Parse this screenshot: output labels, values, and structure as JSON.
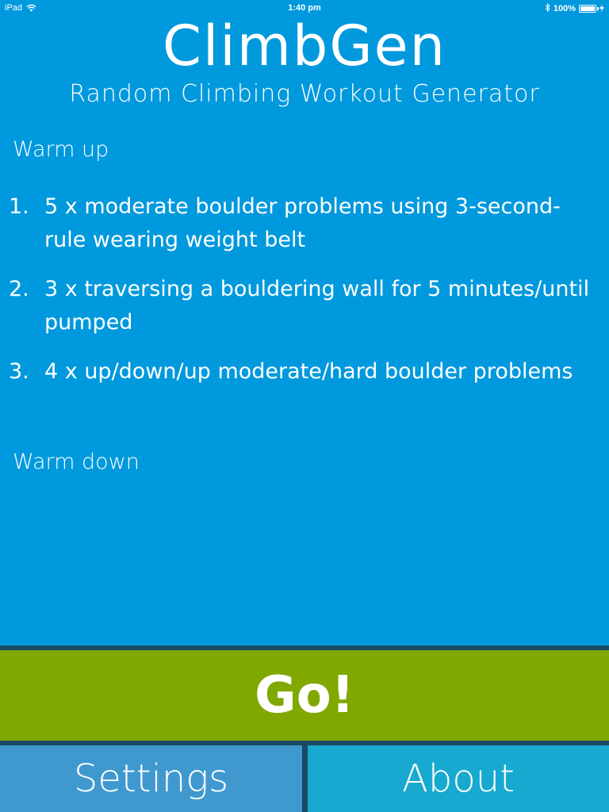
{
  "status_bar": {
    "device": "iPad",
    "time": "1:40 pm",
    "battery": "100%",
    "icons": [
      "wifi-icon",
      "bluetooth-icon",
      "battery-icon",
      "charging-icon"
    ]
  },
  "header": {
    "title": "ClimbGen",
    "subtitle": "Random Climbing Workout Generator"
  },
  "workout": {
    "warmup_label": "Warm up",
    "exercises": [
      {
        "number": "1.",
        "text": "5 x moderate boulder problems using 3-second-rule wearing weight belt"
      },
      {
        "number": "2.",
        "text": "3 x traversing a bouldering wall for 5 minutes/until pumped"
      },
      {
        "number": "3.",
        "text": "4 x up/down/up moderate/hard boulder problems"
      }
    ],
    "warmdown_label": "Warm down"
  },
  "actions": {
    "go_label": "Go!",
    "settings_label": "Settings",
    "about_label": "About"
  },
  "colors": {
    "background": "#0099dd",
    "go_button": "#80a800",
    "settings_button": "#3f99cf",
    "about_button": "#17a9cf",
    "divider": "#1a4a63"
  }
}
